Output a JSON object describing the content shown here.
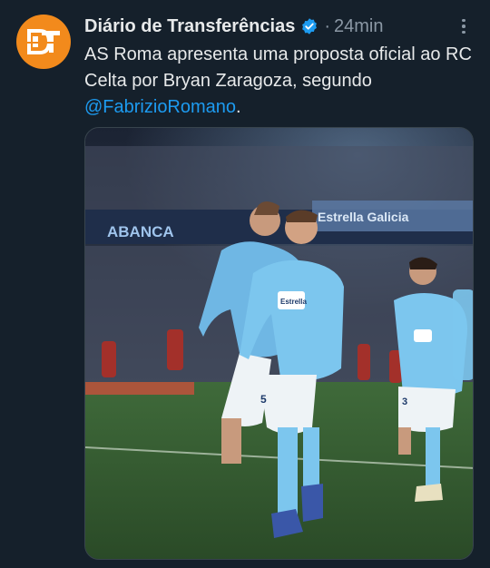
{
  "account": {
    "name": "Diário de Transferências",
    "avatar_initials": "DT",
    "verified_icon": "verified-badge-icon",
    "separator": "·",
    "time": "24min"
  },
  "tweet": {
    "text_part1": "AS Roma apresenta uma proposta oficial ao RC Celta por Bryan Zaragoza, segundo ",
    "mention": "@FabrizioRomano",
    "text_part2": "."
  },
  "media": {
    "description_icon": "photo-football-players-celebrating",
    "ad_board_text": "ABANCA",
    "ad_board_text2": "Estrella Galicia",
    "shirt_sponsor": "Estrella",
    "shirt_number_left": "5",
    "shirt_number_right": "3"
  },
  "colors": {
    "background": "#15202b",
    "accent": "#1d9bf0",
    "avatar": "#f28a1c",
    "secondary_text": "#8b98a5"
  }
}
